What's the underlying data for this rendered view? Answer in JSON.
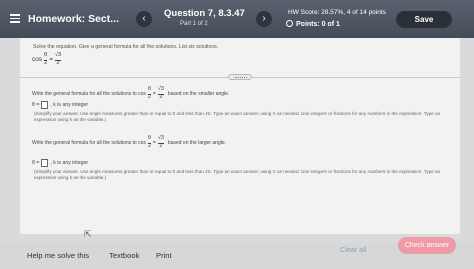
{
  "header": {
    "hw_title": "Homework: Sect...",
    "prev_glyph": "‹",
    "next_glyph": "›",
    "question_title": "Question 7, 8.3.47",
    "question_part": "Part 1 of 2",
    "hw_score": "HW Score: 28.57%, 4 of 14 points",
    "points": "Points: 0 of 1",
    "save_label": "Save"
  },
  "problem": {
    "instruction": "Solve the equation. Give a general formula for all the solutions. List six solutions.",
    "eq_lhs": "cos",
    "eq_theta": "θ",
    "eq_two": "2",
    "eq_equals": "=",
    "eq_sqrt3": "√3",
    "eq_den": "2"
  },
  "part1": {
    "prompt_pre": "Write the general formula for all the solutions to cos",
    "prompt_post": "based on the smaller angle.",
    "theta_eq": "θ =",
    "k_text": ", k is any integer",
    "hint": "(Simplify your answer. Use angle measures greater than or equal to 0 and less than 4π. Type an exact answer, using π as needed. Use integers or fractions for any numbers in the expression. Type an expression using k as the variable.)"
  },
  "part2": {
    "prompt_pre": "Write the general formula for all the solutions to cos",
    "prompt_post": "based on the larger angle.",
    "theta_eq": "θ =",
    "k_text": ", k is any integer",
    "hint": "(Simplify your answer. Use angle measures greater than or equal to 0 and less than 4π. Type an exact answer, using π as needed. Use integers or fractions for any numbers in the expression. Type an expression using k as the variable.)"
  },
  "footer": {
    "help": "Help me solve this",
    "textbook": "Textbook",
    "print": "Print",
    "clear": "Clear all",
    "check": "Check answer"
  },
  "colors": {
    "header_bg": "#4f5663",
    "check_button": "#ef9aa6"
  }
}
